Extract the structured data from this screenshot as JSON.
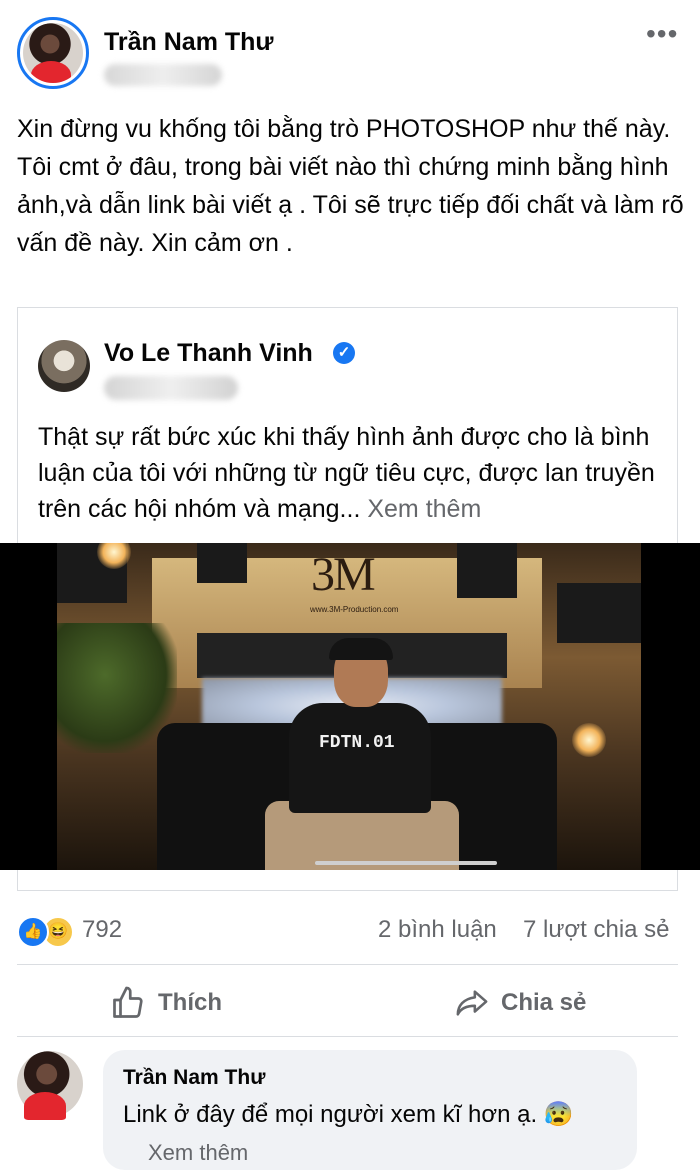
{
  "post": {
    "author": "Trần Nam Thư",
    "more_icon": "ellipsis-icon",
    "text": "Xin đừng vu khống tôi bằng trò PHOTOSHOP như thế này.\nTôi cmt ở đâu, trong bài viết nào thì chứng minh bằng hình ảnh,và dẫn link bài viết ạ . Tôi sẽ trực tiếp đối chất và làm rõ vấn đề này. Xin cảm ơn ."
  },
  "shared_post": {
    "author": "Vo Le Thanh Vinh",
    "verified_icon": "verified-check-icon",
    "text": "Thật sự rất bức xúc khi thấy hình ảnh được cho là bình luận của tôi với những từ ngữ tiêu cực, được lan truyền trên các hội nhóm và mạng... ",
    "see_more": "Xem thêm",
    "video": {
      "logo": "3M",
      "logo_sub": "production",
      "logo_url": "www.3M-Production.com",
      "shirt_text": "FDTN.01"
    }
  },
  "stats": {
    "reactions": "792",
    "reaction_icons": [
      "like-icon",
      "haha-icon"
    ],
    "comments": "2 bình luận",
    "shares": "7 lượt chia sẻ"
  },
  "actions": {
    "like_label": "Thích",
    "share_label": "Chia sẻ"
  },
  "comment": {
    "author": "Trần Nam Thư",
    "text": "Link ở đây để mọi người xem kĩ hơn ạ. 😰",
    "see_more": "Xem thêm"
  },
  "colors": {
    "accent": "#1877f2",
    "secondary_text": "#65676b",
    "bubble": "#f0f2f5"
  }
}
